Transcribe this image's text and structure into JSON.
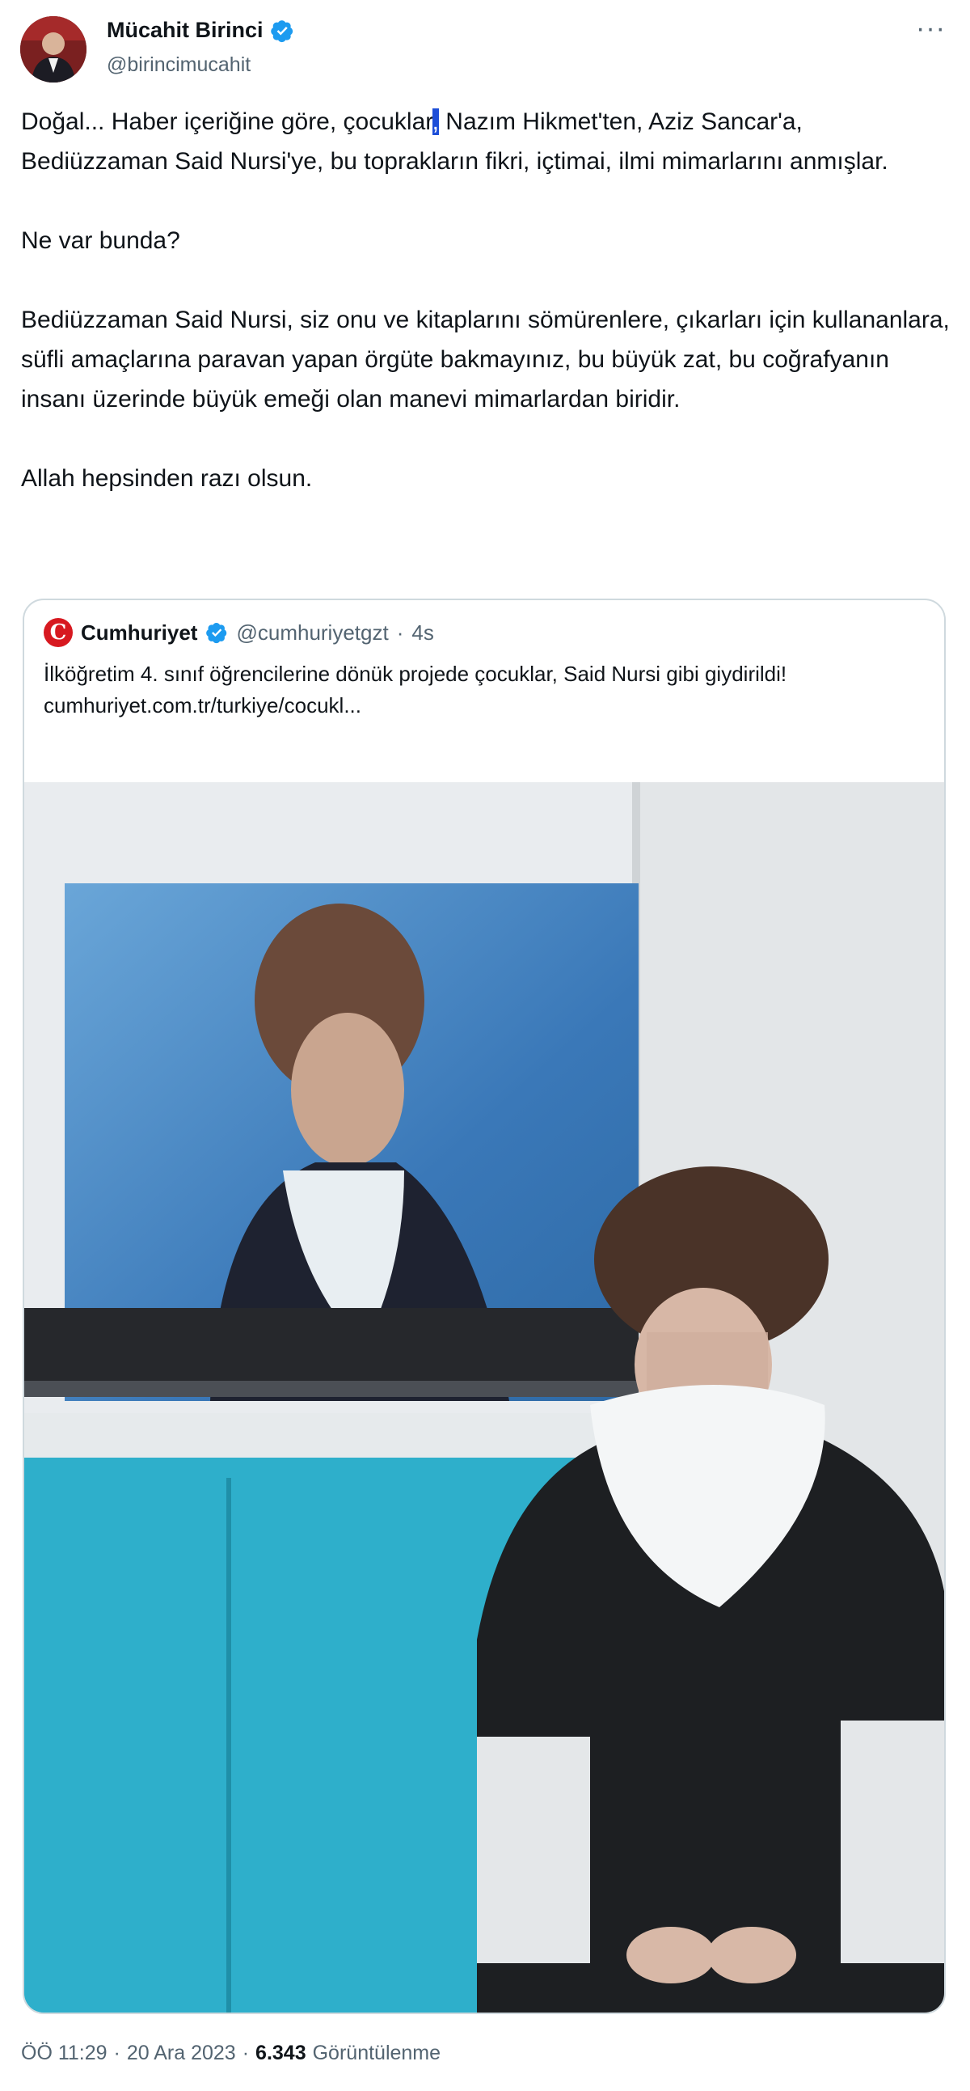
{
  "author": {
    "name": "Mücahit Birinci",
    "handle": "@birincimucahit",
    "verified": true,
    "more_icon": "ellipsis-icon"
  },
  "tweet": {
    "text_before_cursor": "Doğal... Haber içeriğine göre, çocuklar",
    "cursor_char": ",",
    "text_after_cursor": " Nazım Hikmet'ten, Aziz Sancar'a, Bediüzzaman Said Nursi'ye, bu toprakların fikri, içtimai, ilmi mimarlarını anmışlar.\n\nNe var bunda?\n\nBediüzzaman Said Nursi, siz onu ve kitaplarını sömürenlere, çıkarları için kullananlara, süfli amaçlarına paravan yapan örgüte bakmayınız, bu büyük zat, bu coğrafyanın insanı üzerinde büyük emeği olan manevi mimarlardan biridir.\n\nAllah hepsinden razı olsun."
  },
  "quote": {
    "name": "Cumhuriyet",
    "handle": "@cumhuriyetgzt",
    "time": "4s",
    "separator": "·",
    "text": "İlköğretim 4. sınıf öğrencilerine dönük projede çocuklar, Said Nursi gibi giydirildi!",
    "link": "cumhuriyet.com.tr/turkiye/cocukl...",
    "logo_letter": "C"
  },
  "footer": {
    "time": "ÖÖ 11:29",
    "date": "20 Ara 2023",
    "separator": "·",
    "views": "6.343",
    "views_label": "Görüntülenme"
  },
  "colors": {
    "verified": "#1d9bf0",
    "brand_red": "#d71920",
    "muted": "#536471",
    "border": "#cfd9de"
  }
}
